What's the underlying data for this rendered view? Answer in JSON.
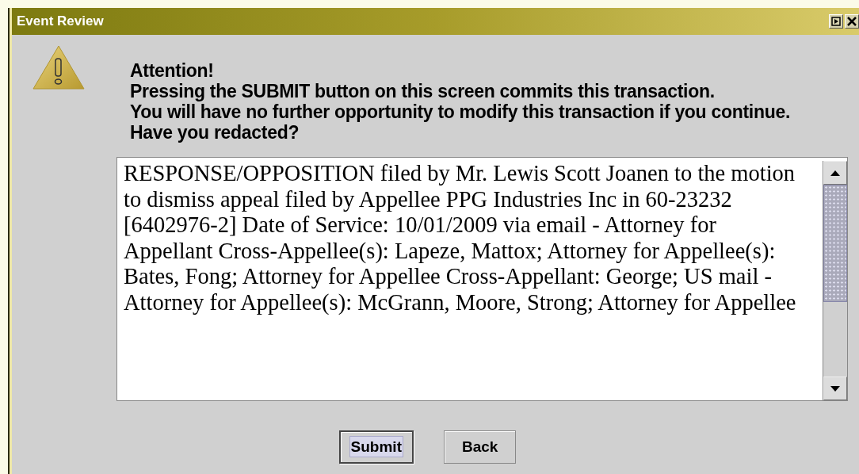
{
  "window": {
    "title": "Event Review"
  },
  "message": {
    "lines": [
      "Attention!",
      "Pressing the SUBMIT button on this screen commits this transaction.",
      "You will have no further opportunity to modify this transaction if you continue.",
      "Have you redacted?"
    ]
  },
  "text_area": {
    "lines": [
      "RESPONSE/OPPOSITION filed by Mr. Lewis Scott Joanen to the motion",
      "to dismiss appeal filed by Appellee PPG Industries Inc in 60-23232",
      "[6402976-2] Date of Service: 10/01/2009 via email - Attorney for",
      "Appellant Cross-Appellee(s): Lapeze, Mattox; Attorney for Appellee(s):",
      "Bates, Fong; Attorney for Appellee Cross-Appellant: George; US mail -",
      "Attorney for Appellee(s): McGrann, Moore, Strong; Attorney for Appellee"
    ]
  },
  "buttons": [
    {
      "label": "Submit",
      "focused": true
    },
    {
      "label": "Back",
      "focused": false
    }
  ]
}
